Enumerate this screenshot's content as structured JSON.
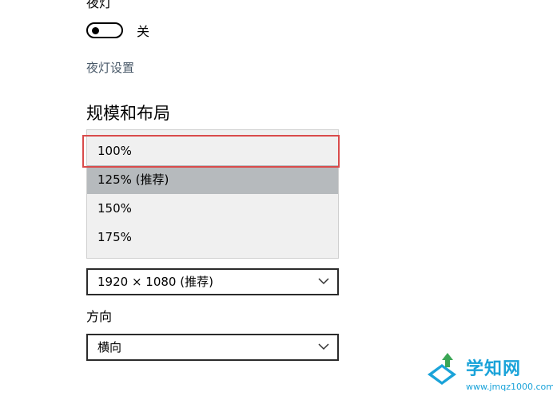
{
  "night_light": {
    "title": "夜灯",
    "toggle_state_label": "关",
    "toggle_on": false,
    "settings_link": "夜灯设置"
  },
  "scale_layout": {
    "title": "规模和布局",
    "scale_options": [
      {
        "label": "100%"
      },
      {
        "label": "125% (推荐)"
      },
      {
        "label": "150%"
      },
      {
        "label": "175%"
      }
    ],
    "highlighted_option": "100%",
    "hovered_option": "125% (推荐)",
    "resolution_value": "1920 × 1080 (推荐)",
    "orientation_label": "方向",
    "orientation_value": "横向"
  },
  "watermark": {
    "brand": "学知网",
    "url": "www.jmqz1000.com",
    "colors": {
      "blue": "#1aa3d9",
      "green": "#3aa655"
    }
  },
  "colors": {
    "highlight_border": "#d94b4b",
    "hover_bg": "#b6babd",
    "list_bg": "#f0f0f0",
    "link": "#4a5a6a"
  }
}
